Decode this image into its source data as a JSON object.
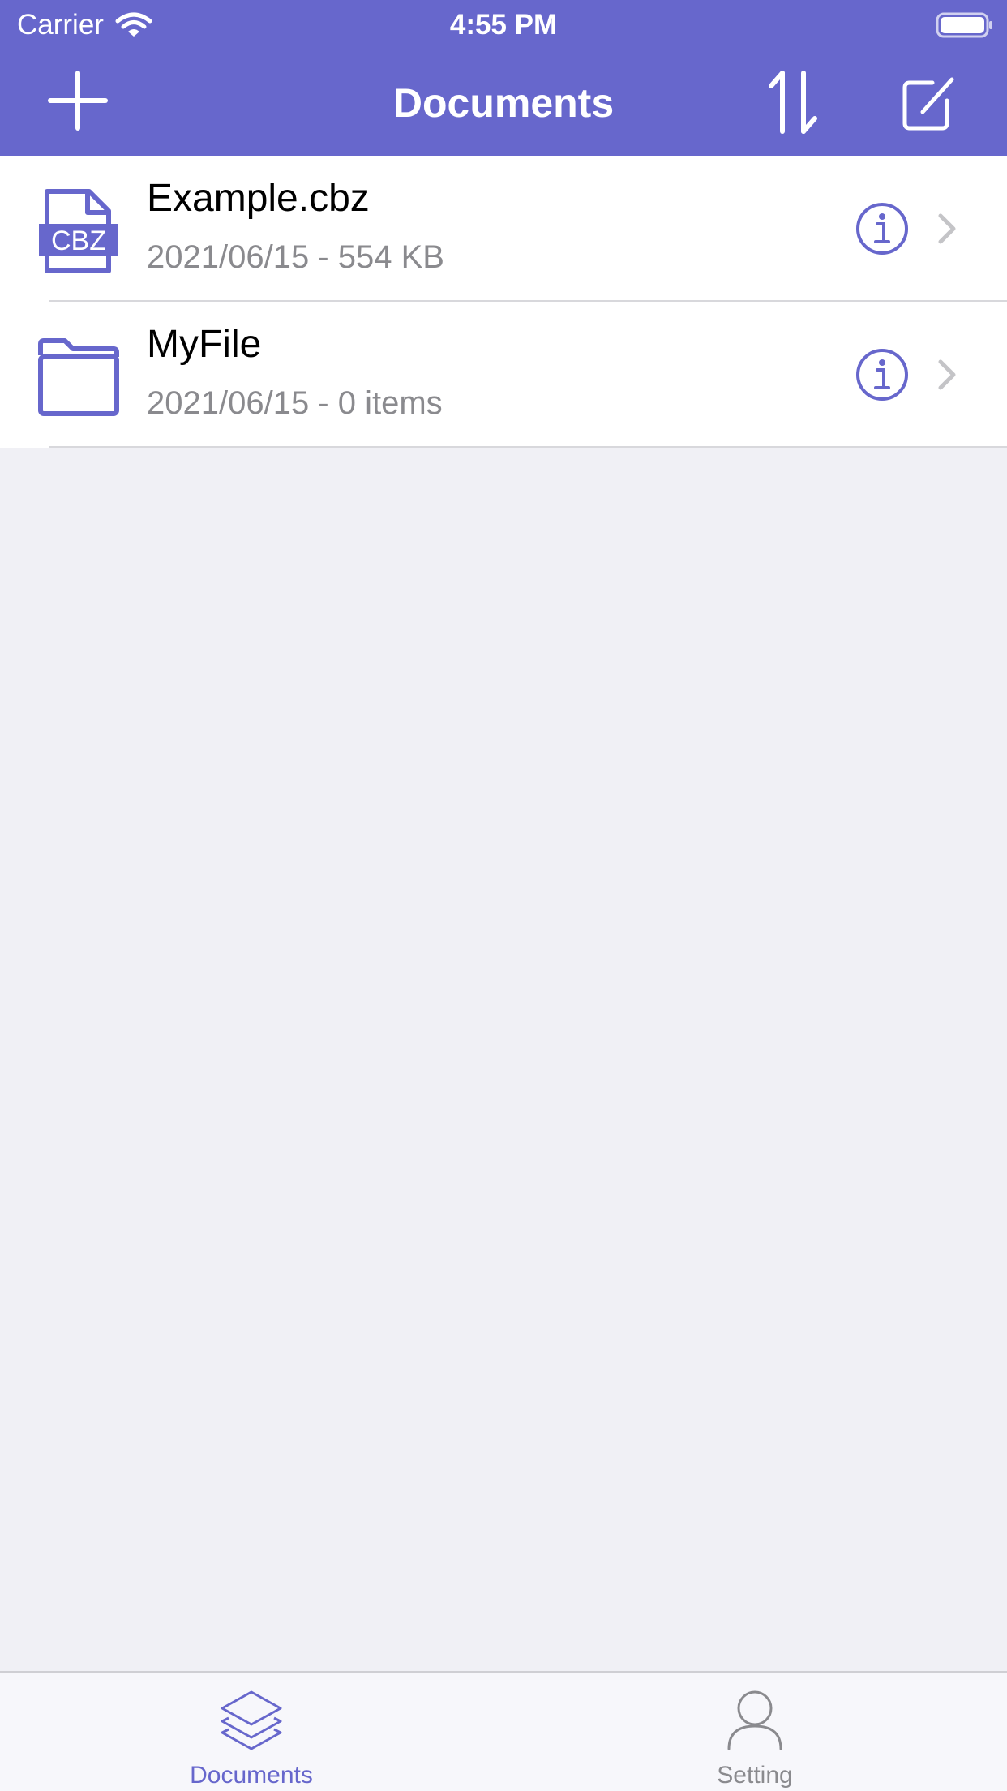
{
  "status_bar": {
    "carrier": "Carrier",
    "time": "4:55 PM",
    "wifi_icon": "wifi-icon",
    "battery_icon": "battery-icon"
  },
  "nav_bar": {
    "title": "Documents",
    "left_button_icon": "plus-icon",
    "right_button_icons": [
      "sort-icon",
      "edit-icon"
    ]
  },
  "files": [
    {
      "name": "Example.cbz",
      "meta": "2021/06/15 - 554 KB",
      "icon": "cbz-file-icon",
      "thumb_label": "CBZ"
    },
    {
      "name": "MyFile",
      "meta": "2021/06/15 - 0 items",
      "icon": "folder-icon"
    }
  ],
  "tab_bar": {
    "tabs": [
      {
        "label": "Documents",
        "icon": "layers-icon",
        "selected": true
      },
      {
        "label": "Setting",
        "icon": "person-icon",
        "selected": false
      }
    ]
  },
  "colors": {
    "accent": "#6767cc",
    "background": "#f0f0f5",
    "secondary_text": "#8a8a8e",
    "chevron": "#c4c4c7"
  }
}
